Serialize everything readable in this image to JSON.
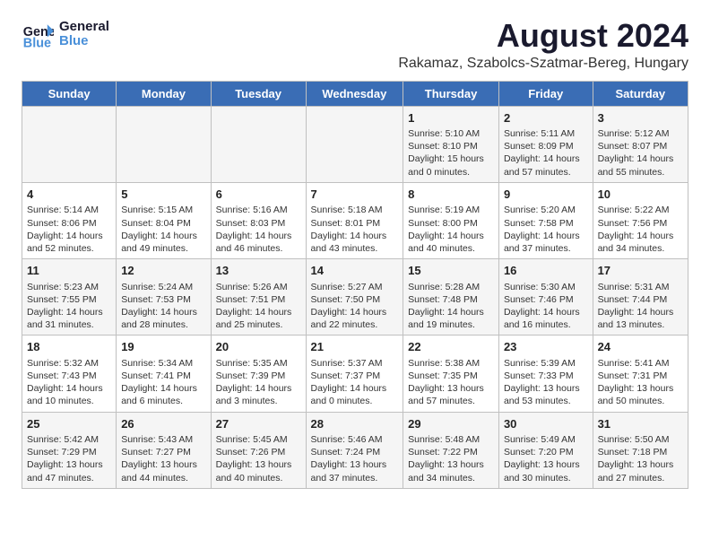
{
  "header": {
    "logo_text_general": "General",
    "logo_text_blue": "Blue",
    "title": "August 2024",
    "subtitle": "Rakamaz, Szabolcs-Szatmar-Bereg, Hungary"
  },
  "weekdays": [
    "Sunday",
    "Monday",
    "Tuesday",
    "Wednesday",
    "Thursday",
    "Friday",
    "Saturday"
  ],
  "weeks": [
    [
      {
        "day": "",
        "info": ""
      },
      {
        "day": "",
        "info": ""
      },
      {
        "day": "",
        "info": ""
      },
      {
        "day": "",
        "info": ""
      },
      {
        "day": "1",
        "info": "Sunrise: 5:10 AM\nSunset: 8:10 PM\nDaylight: 15 hours\nand 0 minutes."
      },
      {
        "day": "2",
        "info": "Sunrise: 5:11 AM\nSunset: 8:09 PM\nDaylight: 14 hours\nand 57 minutes."
      },
      {
        "day": "3",
        "info": "Sunrise: 5:12 AM\nSunset: 8:07 PM\nDaylight: 14 hours\nand 55 minutes."
      }
    ],
    [
      {
        "day": "4",
        "info": "Sunrise: 5:14 AM\nSunset: 8:06 PM\nDaylight: 14 hours\nand 52 minutes."
      },
      {
        "day": "5",
        "info": "Sunrise: 5:15 AM\nSunset: 8:04 PM\nDaylight: 14 hours\nand 49 minutes."
      },
      {
        "day": "6",
        "info": "Sunrise: 5:16 AM\nSunset: 8:03 PM\nDaylight: 14 hours\nand 46 minutes."
      },
      {
        "day": "7",
        "info": "Sunrise: 5:18 AM\nSunset: 8:01 PM\nDaylight: 14 hours\nand 43 minutes."
      },
      {
        "day": "8",
        "info": "Sunrise: 5:19 AM\nSunset: 8:00 PM\nDaylight: 14 hours\nand 40 minutes."
      },
      {
        "day": "9",
        "info": "Sunrise: 5:20 AM\nSunset: 7:58 PM\nDaylight: 14 hours\nand 37 minutes."
      },
      {
        "day": "10",
        "info": "Sunrise: 5:22 AM\nSunset: 7:56 PM\nDaylight: 14 hours\nand 34 minutes."
      }
    ],
    [
      {
        "day": "11",
        "info": "Sunrise: 5:23 AM\nSunset: 7:55 PM\nDaylight: 14 hours\nand 31 minutes."
      },
      {
        "day": "12",
        "info": "Sunrise: 5:24 AM\nSunset: 7:53 PM\nDaylight: 14 hours\nand 28 minutes."
      },
      {
        "day": "13",
        "info": "Sunrise: 5:26 AM\nSunset: 7:51 PM\nDaylight: 14 hours\nand 25 minutes."
      },
      {
        "day": "14",
        "info": "Sunrise: 5:27 AM\nSunset: 7:50 PM\nDaylight: 14 hours\nand 22 minutes."
      },
      {
        "day": "15",
        "info": "Sunrise: 5:28 AM\nSunset: 7:48 PM\nDaylight: 14 hours\nand 19 minutes."
      },
      {
        "day": "16",
        "info": "Sunrise: 5:30 AM\nSunset: 7:46 PM\nDaylight: 14 hours\nand 16 minutes."
      },
      {
        "day": "17",
        "info": "Sunrise: 5:31 AM\nSunset: 7:44 PM\nDaylight: 14 hours\nand 13 minutes."
      }
    ],
    [
      {
        "day": "18",
        "info": "Sunrise: 5:32 AM\nSunset: 7:43 PM\nDaylight: 14 hours\nand 10 minutes."
      },
      {
        "day": "19",
        "info": "Sunrise: 5:34 AM\nSunset: 7:41 PM\nDaylight: 14 hours\nand 6 minutes."
      },
      {
        "day": "20",
        "info": "Sunrise: 5:35 AM\nSunset: 7:39 PM\nDaylight: 14 hours\nand 3 minutes."
      },
      {
        "day": "21",
        "info": "Sunrise: 5:37 AM\nSunset: 7:37 PM\nDaylight: 14 hours\nand 0 minutes."
      },
      {
        "day": "22",
        "info": "Sunrise: 5:38 AM\nSunset: 7:35 PM\nDaylight: 13 hours\nand 57 minutes."
      },
      {
        "day": "23",
        "info": "Sunrise: 5:39 AM\nSunset: 7:33 PM\nDaylight: 13 hours\nand 53 minutes."
      },
      {
        "day": "24",
        "info": "Sunrise: 5:41 AM\nSunset: 7:31 PM\nDaylight: 13 hours\nand 50 minutes."
      }
    ],
    [
      {
        "day": "25",
        "info": "Sunrise: 5:42 AM\nSunset: 7:29 PM\nDaylight: 13 hours\nand 47 minutes."
      },
      {
        "day": "26",
        "info": "Sunrise: 5:43 AM\nSunset: 7:27 PM\nDaylight: 13 hours\nand 44 minutes."
      },
      {
        "day": "27",
        "info": "Sunrise: 5:45 AM\nSunset: 7:26 PM\nDaylight: 13 hours\nand 40 minutes."
      },
      {
        "day": "28",
        "info": "Sunrise: 5:46 AM\nSunset: 7:24 PM\nDaylight: 13 hours\nand 37 minutes."
      },
      {
        "day": "29",
        "info": "Sunrise: 5:48 AM\nSunset: 7:22 PM\nDaylight: 13 hours\nand 34 minutes."
      },
      {
        "day": "30",
        "info": "Sunrise: 5:49 AM\nSunset: 7:20 PM\nDaylight: 13 hours\nand 30 minutes."
      },
      {
        "day": "31",
        "info": "Sunrise: 5:50 AM\nSunset: 7:18 PM\nDaylight: 13 hours\nand 27 minutes."
      }
    ]
  ]
}
